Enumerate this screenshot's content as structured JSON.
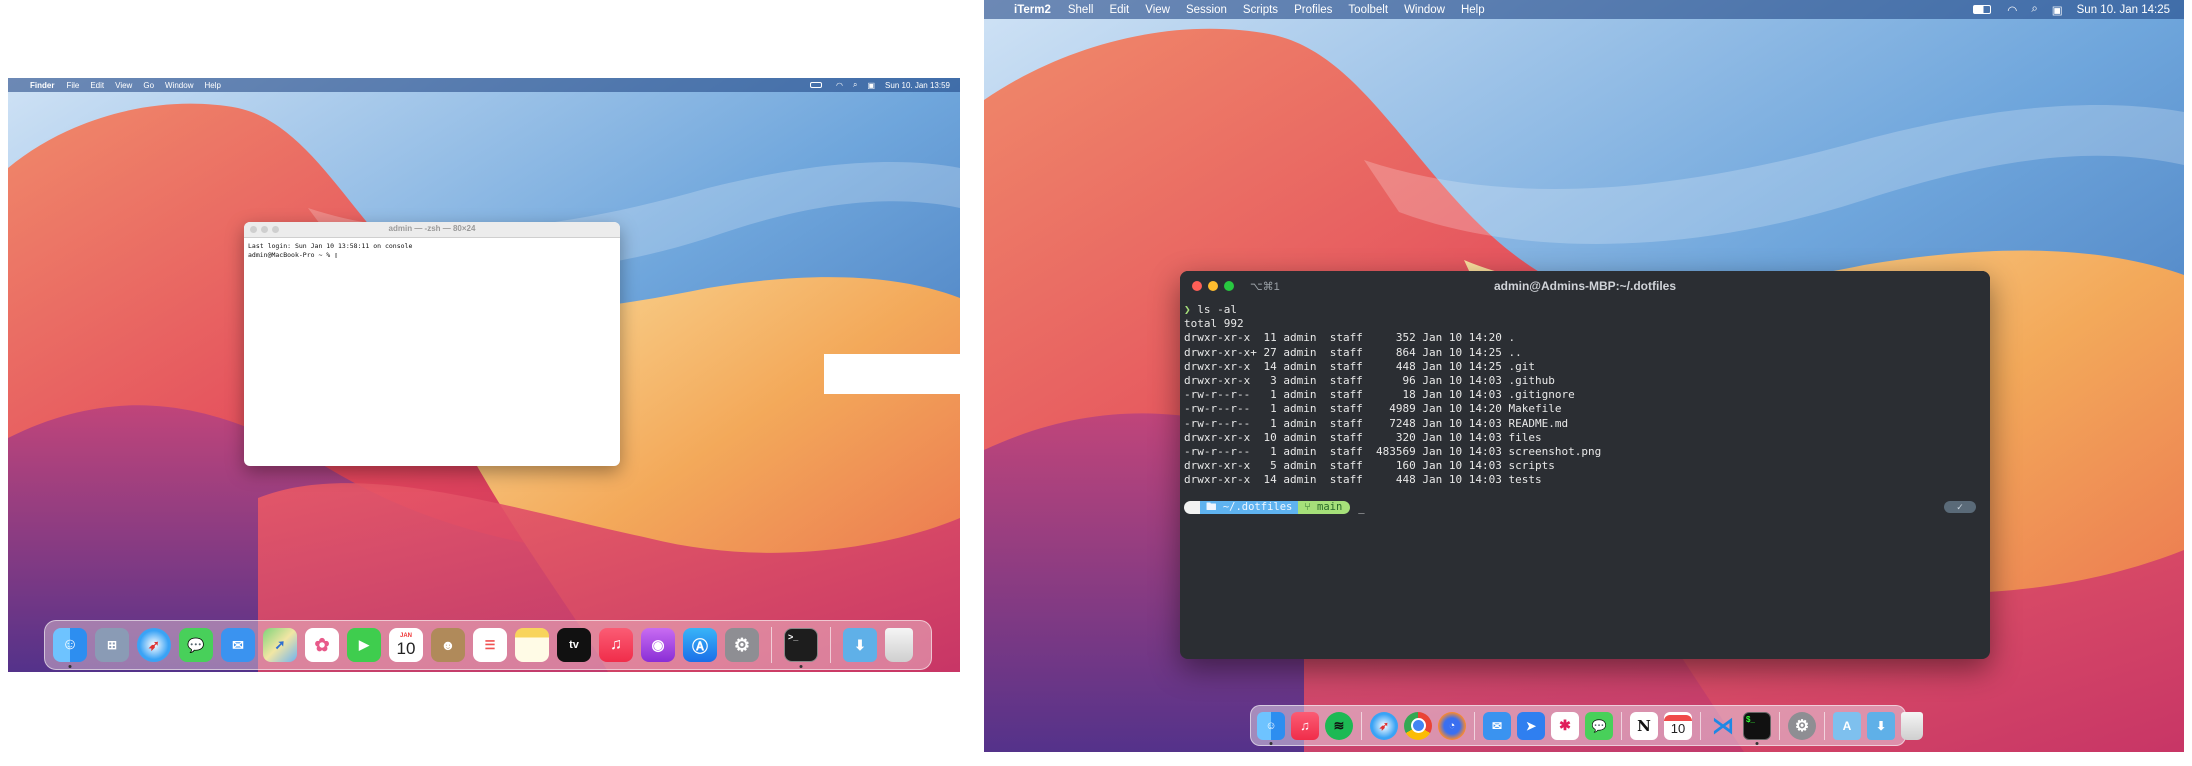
{
  "left_screen": {
    "menubar": {
      "app_name": "Finder",
      "menus": [
        "File",
        "Edit",
        "View",
        "Go",
        "Window",
        "Help"
      ],
      "datetime": "Sun 10. Jan  13:59"
    },
    "terminal": {
      "title": "admin — -zsh — 80×24",
      "lines": [
        "Last login: Sun Jan 10 13:58:11 on console",
        "admin@MacBook-Pro ~ % ▯"
      ]
    },
    "dock": {
      "calendar_month": "JAN",
      "calendar_day": "10",
      "tv_label": "tv"
    }
  },
  "right_screen": {
    "menubar": {
      "app_name": "iTerm2",
      "menus": [
        "Shell",
        "Edit",
        "View",
        "Session",
        "Scripts",
        "Profiles",
        "Toolbelt",
        "Window",
        "Help"
      ],
      "datetime": "Sun 10. Jan  14:25"
    },
    "iterm": {
      "tab_label": "⌥⌘1",
      "title": "admin@Admins-MBP:~/.dotfiles",
      "command": "ls -al",
      "total": "total 992",
      "listing": [
        "drwxr-xr-x  11 admin  staff     352 Jan 10 14:20 .",
        "drwxr-xr-x+ 27 admin  staff     864 Jan 10 14:25 ..",
        "drwxr-xr-x  14 admin  staff     448 Jan 10 14:25 .git",
        "drwxr-xr-x   3 admin  staff      96 Jan 10 14:03 .github",
        "-rw-r--r--   1 admin  staff      18 Jan 10 14:03 .gitignore",
        "-rw-r--r--   1 admin  staff    4989 Jan 10 14:20 Makefile",
        "-rw-r--r--   1 admin  staff    7248 Jan 10 14:03 README.md",
        "drwxr-xr-x  10 admin  staff     320 Jan 10 14:03 files",
        "-rw-r--r--   1 admin  staff  483569 Jan 10 14:03 screenshot.png",
        "drwxr-xr-x   5 admin  staff     160 Jan 10 14:03 scripts",
        "drwxr-xr-x  14 admin  staff     448 Jan 10 14:03 tests"
      ],
      "prompt_dir": "~/.dotfiles",
      "prompt_branch": "main",
      "status_check": "✓",
      "cursor": "_"
    },
    "dock": {
      "calendar_day": "10"
    }
  },
  "colors": {
    "terminal_bg": "#2b2e33",
    "prompt_blue": "#5fb3f0",
    "prompt_green": "#a6e07a",
    "prompt_white": "#f2f2f2"
  }
}
